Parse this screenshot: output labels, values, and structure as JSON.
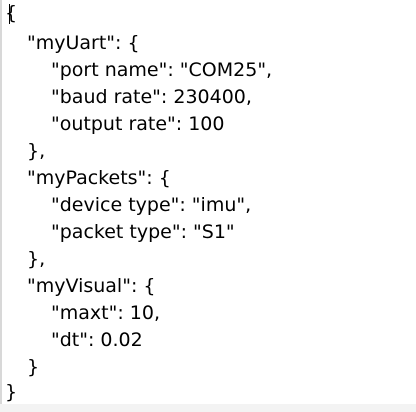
{
  "editor": {
    "lines": [
      {
        "text": "{",
        "indent": 0
      },
      {
        "text": "\"myUart\": {",
        "indent": 1
      },
      {
        "text": "\"port name\": \"COM25\",",
        "indent": 2
      },
      {
        "text": "\"baud rate\": 230400,",
        "indent": 2
      },
      {
        "text": "\"output rate\": 100",
        "indent": 2
      },
      {
        "text": "},",
        "indent": 1
      },
      {
        "text": "\"myPackets\": {",
        "indent": 1
      },
      {
        "text": "\"device type\": \"imu\",",
        "indent": 2
      },
      {
        "text": "\"packet type\": \"S1\"",
        "indent": 2
      },
      {
        "text": "},",
        "indent": 1
      },
      {
        "text": "\"myVisual\": {",
        "indent": 1
      },
      {
        "text": "\"maxt\": 10,",
        "indent": 2
      },
      {
        "text": "\"dt\": 0.02",
        "indent": 2
      },
      {
        "text": "}",
        "indent": 1
      },
      {
        "text": "}",
        "indent": 0
      }
    ]
  }
}
